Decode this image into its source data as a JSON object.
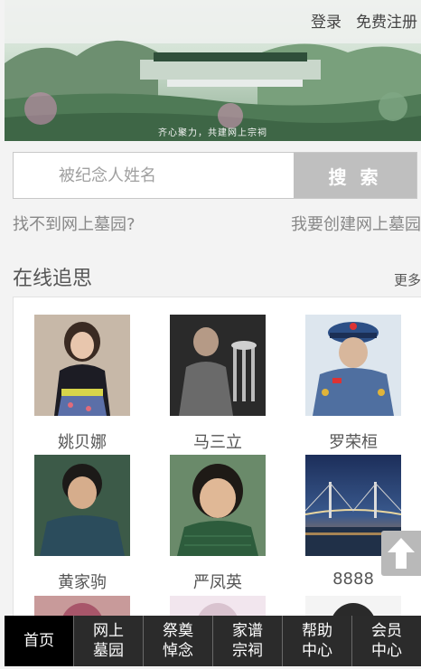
{
  "header": {
    "login_label": "登录",
    "register_label": "免费注册"
  },
  "banner": {
    "slogan": "齐心聚力，共建网上宗祠"
  },
  "search": {
    "placeholder": "被纪念人姓名",
    "button_label": "搜 索"
  },
  "help_links": {
    "not_found": "找不到网上墓园?",
    "create": "我要创建网上墓园"
  },
  "section": {
    "title": "在线追思",
    "more_label": "更多"
  },
  "people": [
    {
      "name": "姚贝娜"
    },
    {
      "name": "马三立"
    },
    {
      "name": "罗荣桓"
    },
    {
      "name": "黄家驹"
    },
    {
      "name": "严凤英"
    },
    {
      "name": "8888"
    }
  ],
  "bottom_nav": [
    {
      "label": "首页",
      "active": true
    },
    {
      "label": "网上\n墓园"
    },
    {
      "label": "祭奠\n悼念"
    },
    {
      "label": "家谱\n宗祠"
    },
    {
      "label": "帮助\n中心"
    },
    {
      "label": "会员\n中心"
    }
  ]
}
